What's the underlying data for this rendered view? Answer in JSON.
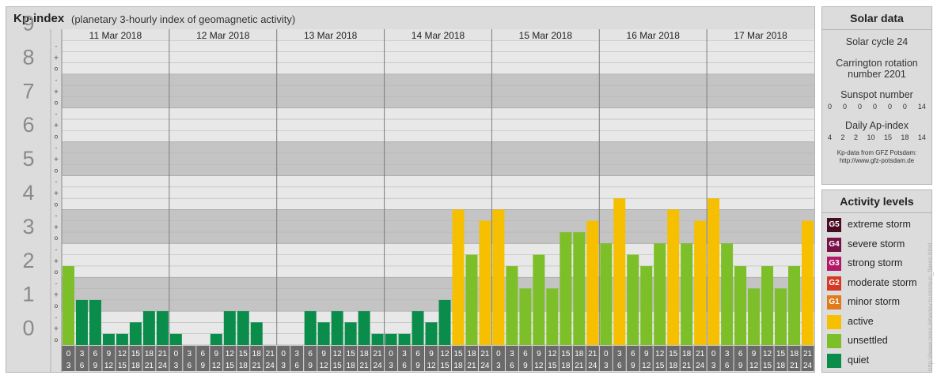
{
  "header": {
    "title": "Kp-index",
    "subtitle": "(planetary 3-hourly index of geomagnetic activity)"
  },
  "chart_data": {
    "type": "bar",
    "ylim": [
      0,
      9
    ],
    "y_major_ticks": [
      "0",
      "1",
      "2",
      "3",
      "4",
      "5",
      "6",
      "7",
      "8",
      "9"
    ],
    "y_minor_ticks": [
      "o",
      "+",
      "-"
    ],
    "days": [
      "11 Mar 2018",
      "12 Mar 2018",
      "13 Mar 2018",
      "14 Mar 2018",
      "15 Mar 2018",
      "16 Mar 2018",
      "17 Mar 2018"
    ],
    "interval_start_hours": [
      "0",
      "3",
      "6",
      "9",
      "12",
      "15",
      "18",
      "21"
    ],
    "interval_end_hours": [
      "3",
      "6",
      "9",
      "12",
      "15",
      "18",
      "21",
      "24"
    ],
    "values": [
      [
        2.33,
        1.33,
        1.33,
        0.33,
        0.33,
        0.67,
        1.0,
        1.0
      ],
      [
        0.33,
        0.0,
        0.0,
        0.33,
        1.0,
        1.0,
        0.67,
        0.0
      ],
      [
        0.0,
        0.0,
        1.0,
        0.67,
        1.0,
        0.67,
        1.0,
        0.33
      ],
      [
        0.33,
        0.33,
        1.0,
        0.67,
        1.33,
        4.0,
        2.67,
        3.67
      ],
      [
        4.0,
        2.33,
        1.67,
        2.67,
        1.67,
        3.33,
        3.33,
        3.67
      ],
      [
        3.0,
        4.33,
        2.67,
        2.33,
        3.0,
        4.0,
        3.0,
        3.67
      ],
      [
        4.33,
        3.0,
        2.33,
        1.67,
        2.33,
        1.67,
        2.33,
        3.67
      ]
    ],
    "level_colors": {
      "quiet": "#0a8c4a",
      "unsettled": "#7cbf28",
      "active": "#f6c000",
      "minor_storm": "#e07a1a",
      "moderate_storm": "#d43a24",
      "strong_storm": "#b3186a",
      "severe_storm": "#7a1048",
      "extreme_storm": "#4a0c24"
    }
  },
  "solar_data": {
    "title": "Solar data",
    "solar_cycle": "Solar cycle 24",
    "carrington_line1": "Carrington rotation",
    "carrington_line2": "number 2201",
    "sunspot_title": "Sunspot number",
    "sunspot_values": [
      "0",
      "0",
      "0",
      "0",
      "0",
      "0",
      "14"
    ],
    "ap_title": "Daily Ap-index",
    "ap_values": [
      "4",
      "2",
      "2",
      "10",
      "15",
      "18",
      "14"
    ],
    "source_line1": "Kp-data from GFZ Potsdam:",
    "source_line2": "http://www.gfz-potsdam.de"
  },
  "activity_levels": {
    "title": "Activity levels",
    "items": [
      {
        "code": "G5",
        "label": "extreme storm",
        "color": "#4a0c24"
      },
      {
        "code": "G4",
        "label": "severe storm",
        "color": "#7a1048"
      },
      {
        "code": "G3",
        "label": "strong storm",
        "color": "#b3186a"
      },
      {
        "code": "G2",
        "label": "moderate storm",
        "color": "#d43a24"
      },
      {
        "code": "G1",
        "label": "minor storm",
        "color": "#e07a1a"
      },
      {
        "code": "",
        "label": "active",
        "color": "#f6c000"
      },
      {
        "code": "",
        "label": "unsettled",
        "color": "#7cbf28"
      },
      {
        "code": "",
        "label": "quiet",
        "color": "#0a8c4a"
      }
    ]
  },
  "watermark": "http://www.tesis.lebedev.ru/en/sun_flares.html"
}
